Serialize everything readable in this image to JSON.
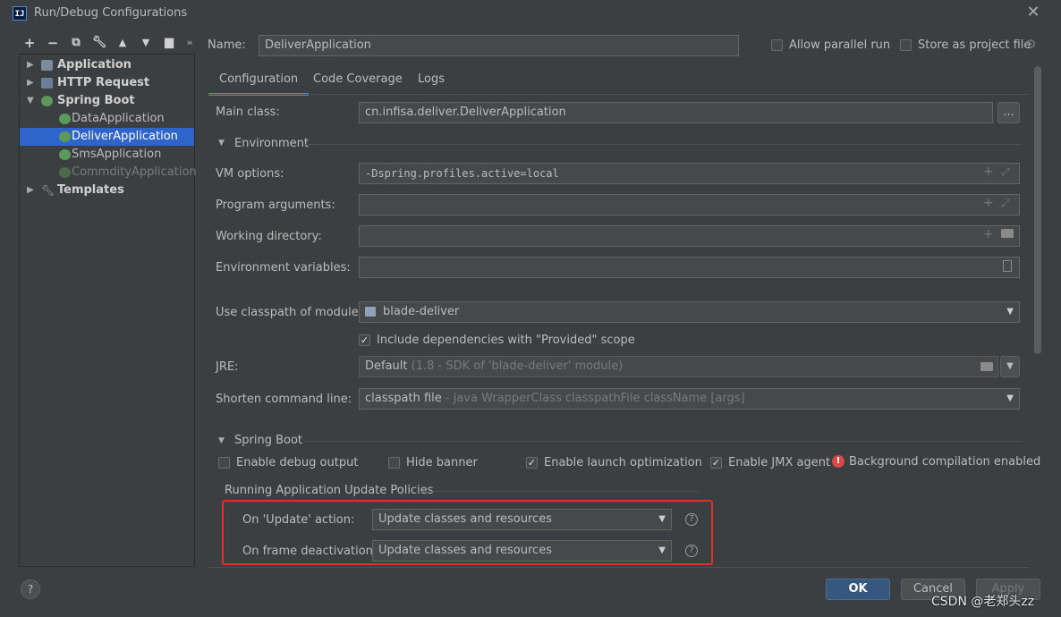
{
  "window": {
    "title": "Run/Debug Configurations",
    "app_icon": "IJ"
  },
  "toolbar": [
    "add-icon",
    "remove-icon",
    "copy-icon",
    "wrench-icon",
    "move-up-icon",
    "move-down-icon",
    "new-folder-icon",
    "more-icon"
  ],
  "tree": {
    "application": "Application",
    "http_request": "HTTP Request",
    "spring_boot": "Spring Boot",
    "children": [
      "DataApplication",
      "DeliverApplication",
      "SmsApplication",
      "CommdityApplication"
    ],
    "templates": "Templates"
  },
  "name": {
    "label": "Name:",
    "value": "DeliverApplication"
  },
  "options": {
    "allow_parallel": "Allow parallel run",
    "store_as_file": "Store as project file"
  },
  "tabs": [
    "Configuration",
    "Code Coverage",
    "Logs"
  ],
  "config": {
    "main_class_label": "Main class:",
    "main_class_value": "cn.infisa.deliver.DeliverApplication",
    "browse": "...",
    "environment_section": "Environment",
    "vm_options_label": "VM options:",
    "vm_options_value": "-Dspring.profiles.active=local",
    "program_args_label": "Program arguments:",
    "working_dir_label": "Working directory:",
    "env_vars_label": "Environment variables:",
    "classpath_label": "Use classpath of module:",
    "classpath_value": "blade-deliver",
    "include_deps": "Include dependencies with \"Provided\" scope",
    "jre_label": "JRE:",
    "jre_value": "Default",
    "jre_hint": "(1.8 - SDK of 'blade-deliver' module)",
    "shorten_label": "Shorten command line:",
    "shorten_value": "classpath file",
    "shorten_hint": "- java WrapperClass classpathFile className [args]"
  },
  "spring_boot": {
    "section": "Spring Boot",
    "enable_debug": "Enable debug output",
    "hide_banner": "Hide banner",
    "launch_opt": "Enable launch optimization",
    "jmx_agent": "Enable JMX agent",
    "bg_compile": "Background compilation enabled",
    "policies_title": "Running Application Update Policies",
    "update_action_label": "On 'Update' action:",
    "update_action_value": "Update classes and resources",
    "frame_deactivation_label": "On frame deactivation:",
    "frame_deactivation_value": "Update classes and resources"
  },
  "footer": {
    "help": "?",
    "ok": "OK",
    "cancel": "Cancel",
    "apply": "Apply",
    "watermark": "CSDN @老郑头zz"
  },
  "colors": {
    "accent": "#2f65ca",
    "highlight": "#e0302a",
    "primary_button": "#365880"
  }
}
